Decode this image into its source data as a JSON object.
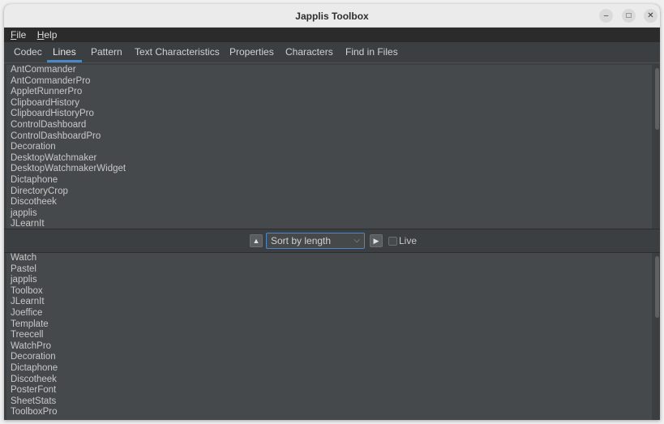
{
  "window": {
    "title": "Japplis Toolbox"
  },
  "menu": [
    {
      "mnemonic": "F",
      "rest": "ile"
    },
    {
      "mnemonic": "H",
      "rest": "elp"
    }
  ],
  "tabs": [
    "Codec",
    "Lines",
    "Pattern",
    "Text Characteristics",
    "Properties",
    "Characters",
    "Find in Files"
  ],
  "active_tab": "Lines",
  "input_lines": [
    "AntCommander",
    "AntCommanderPro",
    "AppletRunnerPro",
    "ClipboardHistory",
    "ClipboardHistoryPro",
    "ControlDashboard",
    "ControlDashboardPro",
    "Decoration",
    "DesktopWatchmaker",
    "DesktopWatchmakerWidget",
    "Dictaphone",
    "DirectoryCrop",
    "Discotheek",
    "japplis",
    "JLearnIt"
  ],
  "toolbar": {
    "sort_value": "Sort by length",
    "live_label": "Live",
    "live_checked": false
  },
  "output_lines": [
    "Watch",
    "Pastel",
    "japplis",
    "Toolbox",
    "JLearnIt",
    "Joeffice",
    "Template",
    "Treecell",
    "WatchPro",
    "Decoration",
    "Dictaphone",
    "Discotheek",
    "PosterFont",
    "SheetStats",
    "ToolboxPro"
  ],
  "colors": {
    "accent": "#4a88c7",
    "background": "#3c3f41",
    "list_background": "#46494b"
  }
}
